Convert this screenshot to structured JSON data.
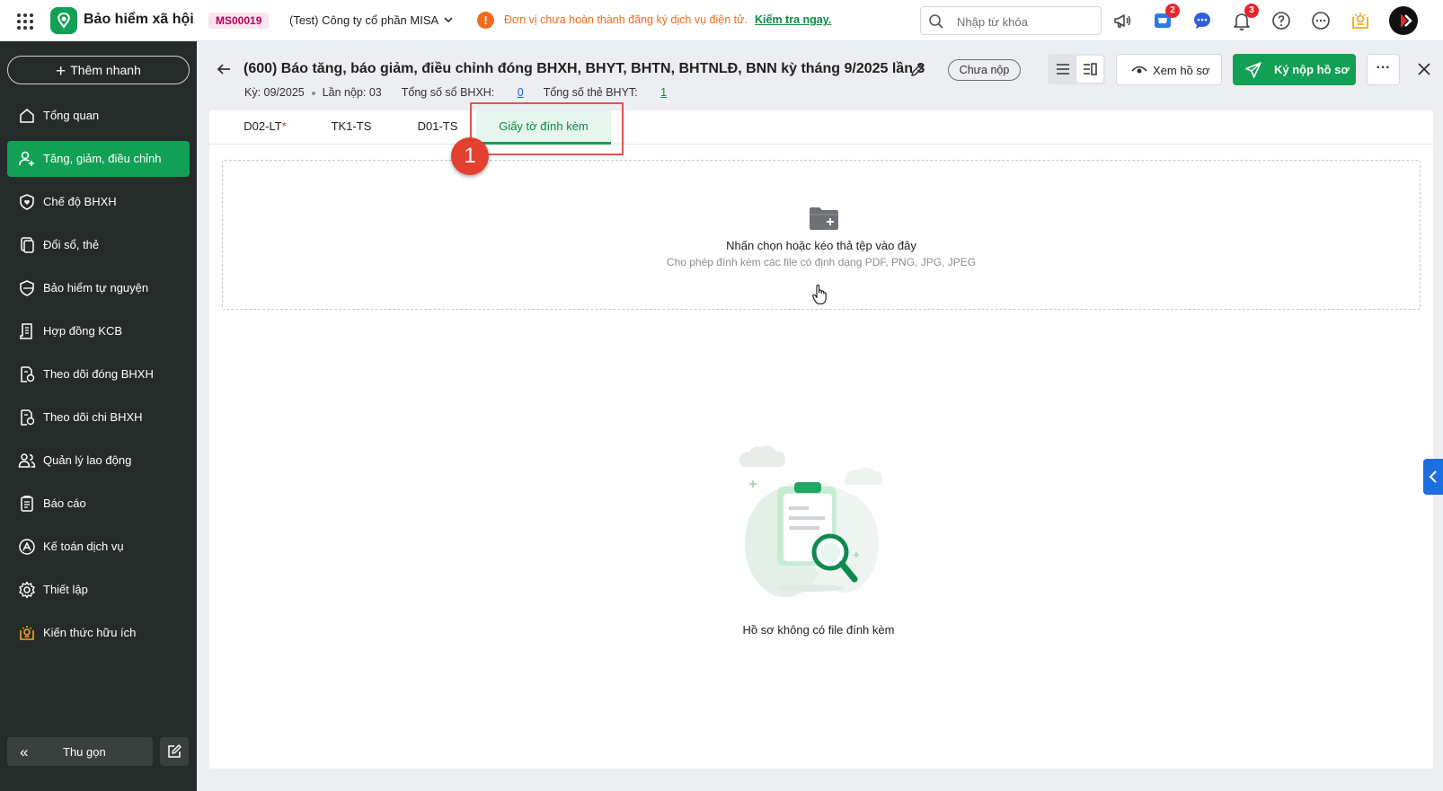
{
  "topbar": {
    "app_name": "Bảo hiểm xã hội",
    "org_code": "MS00019",
    "org_name": "(Test) Công ty cổ phần MISA",
    "warning_text": "Đơn vị chưa hoàn thành đăng ký dịch vụ điện tử.",
    "warning_link": "Kiểm tra ngay.",
    "search_placeholder": "Nhập từ khóa",
    "cart_badge": "2",
    "notification_badge": "3",
    "accent_color": "#12a055",
    "warning_color": "#f26b1d"
  },
  "sidebar": {
    "quick_add": "Thêm nhanh",
    "items": [
      {
        "label": "Tổng quan",
        "icon": "home-icon"
      },
      {
        "label": "Tăng, giảm, điều chỉnh",
        "icon": "user-adjust-icon",
        "active": true
      },
      {
        "label": "Chế độ BHXH",
        "icon": "shield-heart-icon"
      },
      {
        "label": "Đổi sổ, thẻ",
        "icon": "card-swap-icon"
      },
      {
        "label": "Bảo hiểm tự nguyện",
        "icon": "shield-icon"
      },
      {
        "label": "Hợp đồng KCB",
        "icon": "contract-icon"
      },
      {
        "label": "Theo dõi đóng BHXH",
        "icon": "document-track-icon"
      },
      {
        "label": "Theo dõi chi BHXH",
        "icon": "document-payout-icon"
      },
      {
        "label": "Quản lý lao động",
        "icon": "users-icon"
      },
      {
        "label": "Báo cáo",
        "icon": "report-icon"
      },
      {
        "label": "Kế toán dịch vụ",
        "icon": "accounting-icon"
      },
      {
        "label": "Thiết lập",
        "icon": "gear-icon"
      },
      {
        "label": "Kiến thức hữu ích",
        "icon": "knowledge-icon"
      }
    ],
    "collapse_label": "Thu gọn"
  },
  "header": {
    "title": "(600) Báo tăng, báo giảm, điều chỉnh đóng BHXH, BHYT, BHTN, BHTNLĐ, BNN kỳ tháng 9/2025 lần 3",
    "status": "Chưa nộp",
    "period_label": "Kỳ: 09/2025",
    "submission_label": "Lần nộp: 03",
    "total_bhxh_label": "Tổng số sổ BHXH:",
    "total_bhxh_value": "0",
    "total_bhyt_label": "Tổng số thẻ BHYT:",
    "total_bhyt_value": "1",
    "view_button": "Xem hồ sơ",
    "sign_button": "Ký nộp hồ sơ",
    "more_button": "···"
  },
  "tabs": [
    {
      "label": "D02-LT",
      "required": "*"
    },
    {
      "label": "TK1-TS"
    },
    {
      "label": "D01-TS"
    },
    {
      "label": "Giấy tờ đính kèm",
      "active": true
    }
  ],
  "annotation": {
    "step_number": "1"
  },
  "dropzone": {
    "title": "Nhấn chọn hoặc kéo thả tệp vào đây",
    "subtitle": "Cho phép đính kèm các file có định dạng PDF, PNG, JPG, JPEG"
  },
  "empty_state": {
    "text": "Hồ sơ không có file đính kèm"
  }
}
